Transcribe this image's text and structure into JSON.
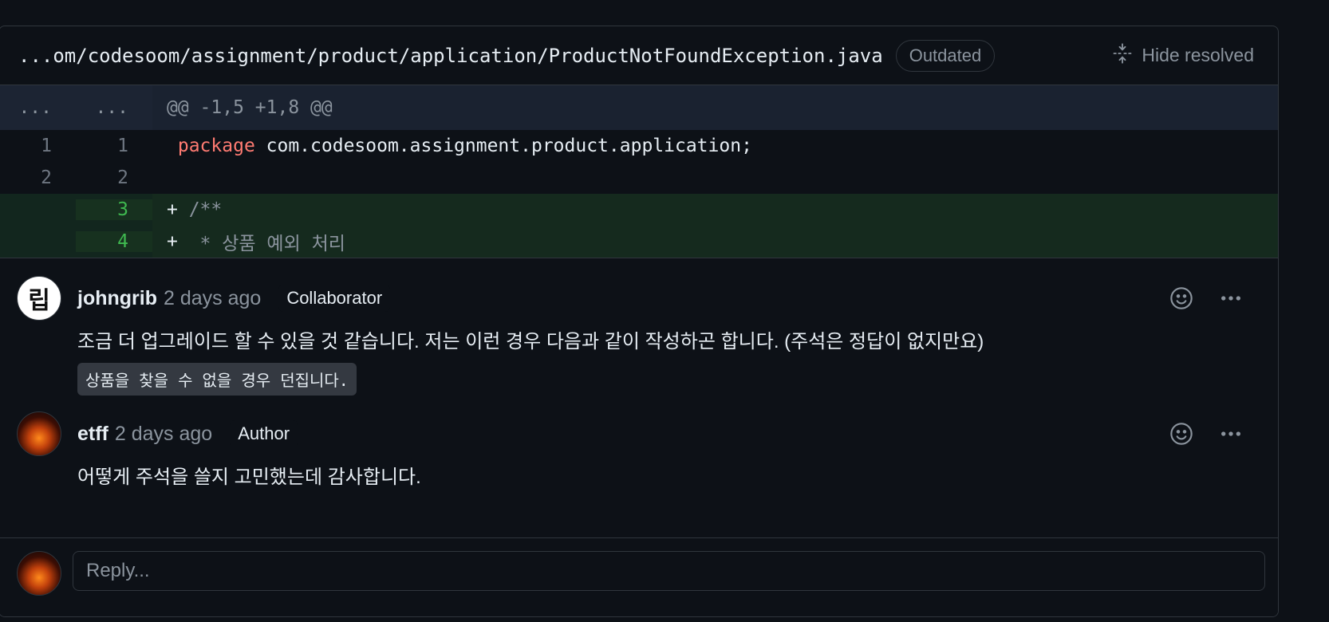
{
  "file": {
    "path": "...om/codesoom/assignment/product/application/ProductNotFoundException.java",
    "badge": "Outdated",
    "hide_resolved_label": "Hide resolved"
  },
  "diff": {
    "hunk": {
      "old": "...",
      "new": "...",
      "text": "@@ -1,5 +1,8 @@"
    },
    "lines": [
      {
        "old": "1",
        "new": "1",
        "prefix": " ",
        "keyword": "package",
        "text": " com.codesoom.assignment.product.application;",
        "type": "context"
      },
      {
        "old": "2",
        "new": "2",
        "prefix": " ",
        "keyword": "",
        "text": "",
        "type": "context"
      },
      {
        "old": "",
        "new": "3",
        "prefix": "+",
        "keyword": "",
        "text": " /**",
        "type": "added"
      },
      {
        "old": "",
        "new": "4",
        "prefix": "+",
        "keyword": "",
        "text": "  * 상품 예외 처리",
        "type": "added"
      }
    ]
  },
  "comments": [
    {
      "avatar_text": "립",
      "author": "johngrib",
      "time": "2 days ago",
      "role": "Collaborator",
      "body": "조금 더 업그레이드 할 수 있을 것 같습니다. 저는 이런 경우 다음과 같이 작성하곤 합니다. (주석은 정답이 없지만요)",
      "code": "상품을 찾을 수 없을 경우 던집니다."
    },
    {
      "avatar_text": "",
      "author": "etff",
      "time": "2 days ago",
      "role": "Author",
      "body": "어떻게 주석을 쓸지 고민했는데 감사합니다."
    }
  ],
  "reply": {
    "placeholder": "Reply..."
  },
  "icons": {
    "hide_resolved": "fold-icon",
    "reaction": "smiley-icon",
    "more": "kebab-horizontal-icon"
  },
  "colors": {
    "background": "#0d1117",
    "border": "#30363d",
    "added_bg": "#12261e",
    "added_num": "#3fb950",
    "keyword": "#ff7b72"
  }
}
